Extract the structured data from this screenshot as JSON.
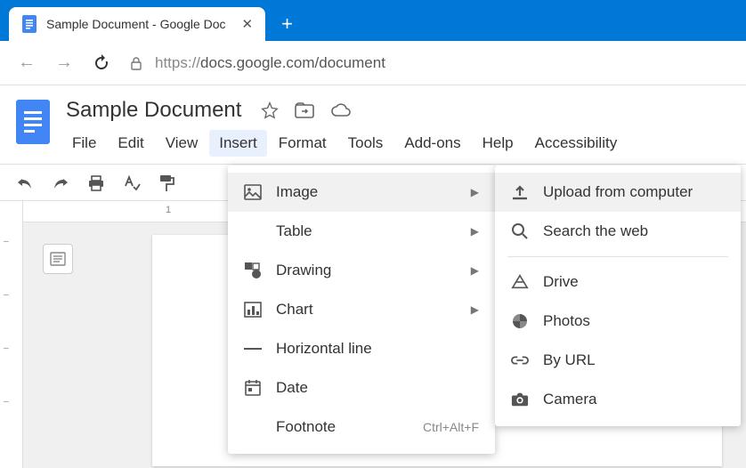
{
  "browser": {
    "tab_title": "Sample Document - Google Doc",
    "url_prefix": "https://",
    "url_rest": "docs.google.com/document"
  },
  "doc": {
    "title": "Sample Document"
  },
  "menubar": [
    "File",
    "Edit",
    "View",
    "Insert",
    "Format",
    "Tools",
    "Add-ons",
    "Help",
    "Accessibility"
  ],
  "active_menu_index": 3,
  "ruler_h": [
    "1"
  ],
  "insert_menu": {
    "items": [
      {
        "icon": "image",
        "label": "Image",
        "submenu": true,
        "hover": true
      },
      {
        "icon": "table",
        "label": "Table",
        "submenu": true
      },
      {
        "icon": "drawing",
        "label": "Drawing",
        "submenu": true
      },
      {
        "icon": "chart",
        "label": "Chart",
        "submenu": true
      },
      {
        "icon": "hr",
        "label": "Horizontal line"
      },
      {
        "icon": "date",
        "label": "Date"
      },
      {
        "icon": "footnote",
        "label": "Footnote",
        "shortcut": "Ctrl+Alt+F"
      }
    ]
  },
  "image_submenu": [
    {
      "icon": "upload",
      "label": "Upload from computer",
      "hover": true
    },
    {
      "icon": "search",
      "label": "Search the web"
    },
    {
      "sep": true
    },
    {
      "icon": "drive",
      "label": "Drive"
    },
    {
      "icon": "photos",
      "label": "Photos"
    },
    {
      "icon": "link",
      "label": "By URL"
    },
    {
      "icon": "camera",
      "label": "Camera"
    }
  ]
}
